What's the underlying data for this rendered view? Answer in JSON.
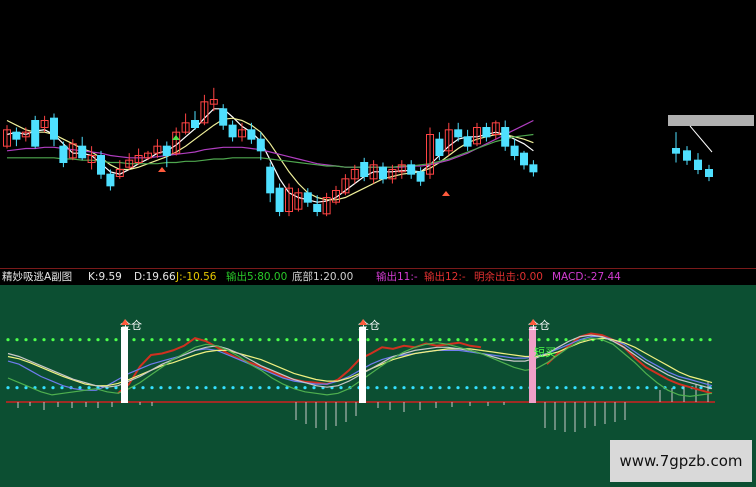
{
  "indicator_name": "精妙吸逃A副图",
  "readouts": [
    {
      "label": "K:",
      "value": "9.59",
      "color": "#e6e6e6"
    },
    {
      "label": "D:",
      "value": "19.66",
      "color": "#e6e6e6"
    },
    {
      "label": "J:",
      "value": "-10.56",
      "color": "#e6c800"
    },
    {
      "label": "输出5:",
      "value": "80.00",
      "color": "#29c929"
    },
    {
      "label": "底部1:",
      "value": "20.00",
      "color": "#d0d0d0"
    },
    {
      "label": "输出11:",
      "value": "-",
      "color": "#d23cd2"
    },
    {
      "label": "输出12:",
      "value": "-",
      "color": "#e03030"
    },
    {
      "label": "明余出击:",
      "value": "0.00",
      "color": "#e03030"
    },
    {
      "label": "MACD:",
      "value": "-27.44",
      "color": "#d23cd2"
    }
  ],
  "signals": [
    {
      "label": "全仓"
    },
    {
      "label": "全仓"
    },
    {
      "label": "全仓"
    },
    {
      "label": "短买"
    }
  ],
  "watermark": "www.7gpzb.com",
  "colors": {
    "up": "#ff4444",
    "down": "#4fe0ff",
    "ma_white": "#ffffff",
    "ma_yellow": "#f0f09a",
    "ma_magenta": "#b03ec0",
    "ma_green": "#4fa84f",
    "sub_background": "#0c4f32",
    "dotted_level": "#4cff4c",
    "dotted_bottom": "#34e0ff"
  },
  "chart_data": [
    {
      "type": "candlestick",
      "title": "",
      "candles": [
        {
          "o": 0.3,
          "c": 0.44,
          "h": 0.48,
          "l": 0.28
        },
        {
          "o": 0.42,
          "c": 0.36,
          "h": 0.46,
          "l": 0.3
        },
        {
          "o": 0.38,
          "c": 0.42,
          "h": 0.46,
          "l": 0.34
        },
        {
          "o": 0.52,
          "c": 0.3,
          "h": 0.56,
          "l": 0.28
        },
        {
          "o": 0.46,
          "c": 0.52,
          "h": 0.56,
          "l": 0.42
        },
        {
          "o": 0.54,
          "c": 0.36,
          "h": 0.58,
          "l": 0.3
        },
        {
          "o": 0.3,
          "c": 0.16,
          "h": 0.34,
          "l": 0.12
        },
        {
          "o": 0.2,
          "c": 0.32,
          "h": 0.36,
          "l": 0.18
        },
        {
          "o": 0.3,
          "c": 0.2,
          "h": 0.38,
          "l": 0.18
        },
        {
          "o": 0.16,
          "c": 0.22,
          "h": 0.3,
          "l": 0.1
        },
        {
          "o": 0.22,
          "c": 0.06,
          "h": 0.26,
          "l": 0.02
        },
        {
          "o": 0.06,
          "c": -0.04,
          "h": 0.1,
          "l": -0.08
        },
        {
          "o": 0.04,
          "c": 0.1,
          "h": 0.18,
          "l": 0.02
        },
        {
          "o": 0.12,
          "c": 0.18,
          "h": 0.24,
          "l": 0.1
        },
        {
          "o": 0.16,
          "c": 0.22,
          "h": 0.28,
          "l": 0.14
        },
        {
          "o": 0.2,
          "c": 0.24,
          "h": 0.26,
          "l": 0.18
        },
        {
          "o": 0.24,
          "c": 0.3,
          "h": 0.36,
          "l": 0.2
        },
        {
          "o": 0.3,
          "c": 0.22,
          "h": 0.34,
          "l": 0.12
        },
        {
          "o": 0.24,
          "c": 0.42,
          "h": 0.46,
          "l": 0.22
        },
        {
          "o": 0.42,
          "c": 0.5,
          "h": 0.58,
          "l": 0.4
        },
        {
          "o": 0.52,
          "c": 0.46,
          "h": 0.6,
          "l": 0.44
        },
        {
          "o": 0.5,
          "c": 0.68,
          "h": 0.74,
          "l": 0.48
        },
        {
          "o": 0.66,
          "c": 0.7,
          "h": 0.8,
          "l": 0.6
        },
        {
          "o": 0.62,
          "c": 0.48,
          "h": 0.66,
          "l": 0.44
        },
        {
          "o": 0.48,
          "c": 0.38,
          "h": 0.52,
          "l": 0.34
        },
        {
          "o": 0.38,
          "c": 0.44,
          "h": 0.5,
          "l": 0.34
        },
        {
          "o": 0.44,
          "c": 0.36,
          "h": 0.5,
          "l": 0.32
        },
        {
          "o": 0.36,
          "c": 0.26,
          "h": 0.42,
          "l": 0.18
        },
        {
          "o": 0.12,
          "c": -0.1,
          "h": 0.16,
          "l": -0.18
        },
        {
          "o": -0.06,
          "c": -0.26,
          "h": -0.02,
          "l": -0.3
        },
        {
          "o": -0.26,
          "c": -0.06,
          "h": -0.02,
          "l": -0.3
        },
        {
          "o": -0.24,
          "c": -0.1,
          "h": -0.06,
          "l": -0.26
        },
        {
          "o": -0.1,
          "c": -0.18,
          "h": -0.06,
          "l": -0.22
        },
        {
          "o": -0.2,
          "c": -0.26,
          "h": -0.12,
          "l": -0.3
        },
        {
          "o": -0.28,
          "c": -0.14,
          "h": -0.1,
          "l": -0.3
        },
        {
          "o": -0.18,
          "c": -0.08,
          "h": -0.04,
          "l": -0.2
        },
        {
          "o": -0.1,
          "c": 0.02,
          "h": 0.06,
          "l": -0.12
        },
        {
          "o": 0.02,
          "c": 0.1,
          "h": 0.14,
          "l": -0.02
        },
        {
          "o": 0.16,
          "c": 0.04,
          "h": 0.2,
          "l": 0.0
        },
        {
          "o": 0.02,
          "c": 0.14,
          "h": 0.18,
          "l": -0.02
        },
        {
          "o": 0.12,
          "c": 0.02,
          "h": 0.16,
          "l": -0.02
        },
        {
          "o": 0.02,
          "c": 0.1,
          "h": 0.14,
          "l": -0.02
        },
        {
          "o": 0.08,
          "c": 0.14,
          "h": 0.18,
          "l": 0.02
        },
        {
          "o": 0.14,
          "c": 0.06,
          "h": 0.18,
          "l": 0.02
        },
        {
          "o": 0.08,
          "c": 0.0,
          "h": 0.12,
          "l": -0.04
        },
        {
          "o": 0.06,
          "c": 0.4,
          "h": 0.46,
          "l": 0.02
        },
        {
          "o": 0.36,
          "c": 0.22,
          "h": 0.42,
          "l": 0.18
        },
        {
          "o": 0.26,
          "c": 0.44,
          "h": 0.5,
          "l": 0.22
        },
        {
          "o": 0.44,
          "c": 0.38,
          "h": 0.5,
          "l": 0.34
        },
        {
          "o": 0.38,
          "c": 0.3,
          "h": 0.44,
          "l": 0.26
        },
        {
          "o": 0.32,
          "c": 0.46,
          "h": 0.5,
          "l": 0.3
        },
        {
          "o": 0.46,
          "c": 0.38,
          "h": 0.5,
          "l": 0.34
        },
        {
          "o": 0.4,
          "c": 0.5,
          "h": 0.52,
          "l": 0.36
        },
        {
          "o": 0.46,
          "c": 0.3,
          "h": 0.52,
          "l": 0.26
        },
        {
          "o": 0.3,
          "c": 0.22,
          "h": 0.36,
          "l": 0.18
        },
        {
          "o": 0.24,
          "c": 0.14,
          "h": 0.26,
          "l": 0.1
        },
        {
          "o": 0.14,
          "c": 0.08,
          "h": 0.18,
          "l": 0.04
        }
      ],
      "ma_lines": [
        {
          "color": "#ffffff",
          "values": [
            0.4,
            0.42,
            0.4,
            0.43,
            0.44,
            0.4,
            0.32,
            0.24,
            0.24,
            0.22,
            0.15,
            0.08,
            0.06,
            0.1,
            0.15,
            0.19,
            0.24,
            0.26,
            0.31,
            0.38,
            0.45,
            0.54,
            0.62,
            0.62,
            0.55,
            0.47,
            0.42,
            0.34,
            0.18,
            0.02,
            -0.1,
            -0.14,
            -0.16,
            -0.18,
            -0.17,
            -0.14,
            -0.08,
            -0.02,
            0.04,
            0.08,
            0.08,
            0.08,
            0.09,
            0.09,
            0.08,
            0.14,
            0.22,
            0.3,
            0.36,
            0.38,
            0.38,
            0.4,
            0.42,
            0.4,
            0.36,
            0.32,
            0.26
          ]
        },
        {
          "color": "#f0f09a",
          "values": [
            0.52,
            0.48,
            0.44,
            0.42,
            0.42,
            0.4,
            0.36,
            0.32,
            0.28,
            0.25,
            0.2,
            0.14,
            0.1,
            0.1,
            0.12,
            0.15,
            0.18,
            0.21,
            0.25,
            0.3,
            0.36,
            0.42,
            0.48,
            0.53,
            0.54,
            0.52,
            0.48,
            0.42,
            0.32,
            0.2,
            0.08,
            -0.02,
            -0.1,
            -0.14,
            -0.16,
            -0.16,
            -0.14,
            -0.1,
            -0.06,
            -0.02,
            0.02,
            0.04,
            0.06,
            0.07,
            0.08,
            0.11,
            0.16,
            0.22,
            0.28,
            0.33,
            0.36,
            0.38,
            0.4,
            0.4,
            0.38,
            0.36,
            0.33
          ]
        },
        {
          "color": "#b03ec0",
          "values": [
            0.26,
            0.27,
            0.28,
            0.28,
            0.29,
            0.29,
            0.28,
            0.27,
            0.26,
            0.25,
            0.24,
            0.22,
            0.21,
            0.2,
            0.2,
            0.2,
            0.21,
            0.22,
            0.23,
            0.24,
            0.25,
            0.27,
            0.28,
            0.29,
            0.29,
            0.29,
            0.28,
            0.27,
            0.25,
            0.23,
            0.21,
            0.19,
            0.17,
            0.15,
            0.14,
            0.13,
            0.12,
            0.12,
            0.12,
            0.12,
            0.12,
            0.12,
            0.12,
            0.13,
            0.13,
            0.14,
            0.16,
            0.18,
            0.21,
            0.24,
            0.28,
            0.32,
            0.36,
            0.4,
            0.44,
            0.48,
            0.52
          ]
        },
        {
          "color": "#4fa84f",
          "values": [
            0.2,
            0.2,
            0.2,
            0.2,
            0.2,
            0.2,
            0.19,
            0.19,
            0.18,
            0.18,
            0.17,
            0.16,
            0.16,
            0.15,
            0.15,
            0.15,
            0.15,
            0.16,
            0.16,
            0.17,
            0.17,
            0.18,
            0.19,
            0.19,
            0.2,
            0.2,
            0.2,
            0.2,
            0.19,
            0.18,
            0.17,
            0.16,
            0.15,
            0.14,
            0.13,
            0.13,
            0.12,
            0.12,
            0.12,
            0.12,
            0.12,
            0.12,
            0.13,
            0.13,
            0.14,
            0.15,
            0.17,
            0.19,
            0.22,
            0.25,
            0.28,
            0.31,
            0.34,
            0.36,
            0.38,
            0.39,
            0.4
          ]
        }
      ],
      "right_segment": [
        {
          "o": 0.28,
          "c": 0.24,
          "h": 0.42,
          "l": 0.16
        },
        {
          "o": 0.26,
          "c": 0.18,
          "h": 0.3,
          "l": 0.14
        },
        {
          "o": 0.18,
          "c": 0.1,
          "h": 0.24,
          "l": 0.06
        },
        {
          "o": 0.1,
          "c": 0.04,
          "h": 0.14,
          "l": 0.0
        }
      ]
    },
    {
      "type": "line",
      "title": "",
      "levels": [
        80,
        20
      ],
      "series": [
        {
          "color": "#d03020",
          "values": [
            null,
            null,
            null,
            null,
            null,
            null,
            null,
            null,
            null,
            null,
            10,
            22,
            45,
            60,
            62,
            66,
            72,
            82,
            78,
            70,
            62,
            55,
            50,
            45,
            38,
            32,
            28,
            25,
            24,
            22,
            28,
            40,
            55,
            62,
            70,
            68,
            72,
            70,
            75,
            72,
            74,
            76,
            72,
            70,
            null,
            null,
            null,
            null,
            null,
            48,
            62,
            72,
            84,
            88,
            86,
            80,
            70,
            56,
            44,
            36,
            28,
            22,
            18,
            14,
            10
          ]
        },
        {
          "color": "#6f7cf0",
          "values": [
            52,
            48,
            40,
            32,
            26,
            20,
            16,
            14,
            14,
            20,
            28,
            36,
            42,
            48,
            52,
            56,
            60,
            66,
            68,
            66,
            60,
            54,
            48,
            42,
            36,
            30,
            26,
            24,
            22,
            22,
            26,
            32,
            40,
            48,
            54,
            58,
            60,
            62,
            64,
            66,
            66,
            66,
            64,
            62,
            60,
            58,
            56,
            56,
            58,
            62,
            68,
            74,
            80,
            84,
            84,
            80,
            74,
            64,
            54,
            46,
            38,
            32,
            28,
            24,
            20
          ]
        },
        {
          "color": "#f0f080",
          "values": [
            58,
            55,
            50,
            44,
            38,
            32,
            27,
            22,
            20,
            20,
            23,
            28,
            34,
            40,
            46,
            50,
            55,
            60,
            64,
            66,
            66,
            62,
            58,
            54,
            48,
            42,
            36,
            32,
            28,
            26,
            26,
            30,
            36,
            42,
            48,
            54,
            58,
            62,
            64,
            66,
            68,
            68,
            68,
            66,
            64,
            62,
            60,
            58,
            58,
            60,
            64,
            70,
            76,
            80,
            82,
            80,
            76,
            70,
            62,
            54,
            46,
            38,
            32,
            28,
            24
          ]
        },
        {
          "color": "#c8c8c8",
          "values": [
            62,
            58,
            52,
            46,
            40,
            34,
            28,
            24,
            20,
            18,
            20,
            26,
            32,
            40,
            48,
            54,
            60,
            66,
            70,
            72,
            68,
            62,
            54,
            46,
            40,
            34,
            28,
            24,
            20,
            18,
            20,
            26,
            34,
            42,
            50,
            58,
            62,
            66,
            68,
            70,
            70,
            68,
            66,
            62,
            58,
            54,
            52,
            52,
            56,
            62,
            70,
            78,
            84,
            86,
            84,
            78,
            70,
            60,
            50,
            42,
            34,
            28,
            24,
            20,
            16
          ]
        },
        {
          "color": "#4fb04f",
          "values": [
            30,
            24,
            18,
            12,
            8,
            10,
            12,
            14,
            16,
            12,
            10,
            16,
            24,
            34,
            44,
            54,
            62,
            70,
            74,
            72,
            66,
            58,
            48,
            40,
            30,
            22,
            16,
            12,
            10,
            8,
            10,
            16,
            26,
            36,
            46,
            56,
            64,
            70,
            74,
            76,
            74,
            70,
            66,
            62,
            56,
            50,
            44,
            40,
            42,
            50,
            60,
            70,
            78,
            82,
            80,
            74,
            62,
            50,
            36,
            24,
            14,
            8,
            6,
            8,
            10
          ]
        }
      ],
      "signal_bars": [
        {
          "x": "signal-1",
          "color": "#ffffff"
        },
        {
          "x": "signal-2",
          "color": "#ffffff"
        },
        {
          "x": "signal-3",
          "color": "#f0a0c8"
        }
      ]
    }
  ]
}
